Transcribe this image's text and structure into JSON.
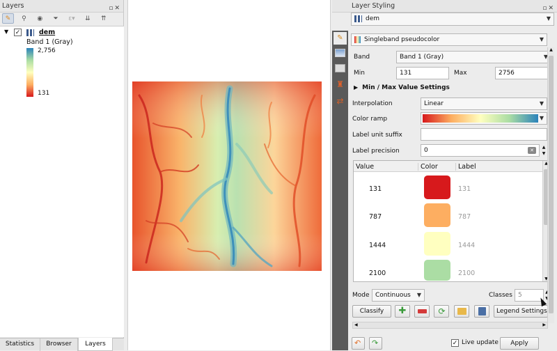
{
  "layers_panel": {
    "title": "Layers",
    "layer_name": "dem",
    "band_label": "Band 1 (Gray)",
    "legend_max": "2,756",
    "legend_min": "131",
    "bottom_tabs": [
      "Statistics",
      "Browser",
      "Layers"
    ],
    "active_tab": "Layers"
  },
  "styling_panel": {
    "title": "Layer Styling",
    "layer_select": "dem",
    "renderer": "Singleband pseudocolor",
    "band_label": "Band",
    "band_value": "Band 1 (Gray)",
    "min_label": "Min",
    "min_value": "131",
    "max_label": "Max",
    "max_value": "2756",
    "minmax_section": "Min / Max Value Settings",
    "interpolation_label": "Interpolation",
    "interpolation_value": "Linear",
    "color_ramp_label": "Color ramp",
    "unit_suffix_label": "Label unit suffix",
    "unit_suffix_value": "",
    "precision_label": "Label precision",
    "precision_value": "0",
    "table_headers": [
      "Value",
      "Color",
      "Label"
    ],
    "classes": [
      {
        "value": "131",
        "color": "#d7191c",
        "label": "131"
      },
      {
        "value": "787",
        "color": "#fdae61",
        "label": "787"
      },
      {
        "value": "1444",
        "color": "#ffffc0",
        "label": "1444"
      },
      {
        "value": "2100",
        "color": "#abdda4",
        "label": "2100"
      }
    ],
    "mode_label": "Mode",
    "mode_value": "Continuous",
    "classes_label": "Classes",
    "classes_value": "5",
    "classify_label": "Classify",
    "legend_settings_label": "Legend Settings...",
    "live_update_label": "Live update",
    "live_update_checked": true,
    "apply_label": "Apply"
  },
  "colors": {
    "ramp": [
      "#d7191c",
      "#fdae61",
      "#ffffbf",
      "#abdda4",
      "#2b83ba"
    ]
  }
}
